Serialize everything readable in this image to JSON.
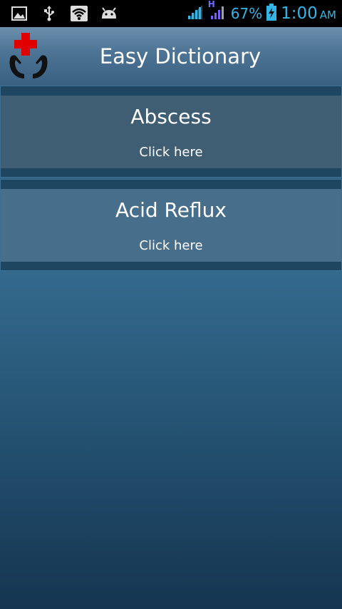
{
  "status_bar": {
    "icons_left": [
      "image-icon",
      "usb-icon",
      "wifi-icon",
      "android-icon"
    ],
    "battery_percent": "67%",
    "time": "1:00",
    "ampm": "AM",
    "network_type": "H",
    "accent_color": "#33b5e5"
  },
  "action_bar": {
    "title": "Easy Dictionary",
    "logo_icon": "medical-hands-cross-icon"
  },
  "list": {
    "items": [
      {
        "title": "Abscess",
        "subtitle": "Click here"
      },
      {
        "title": "Acid Reflux",
        "subtitle": "Click here"
      }
    ]
  }
}
